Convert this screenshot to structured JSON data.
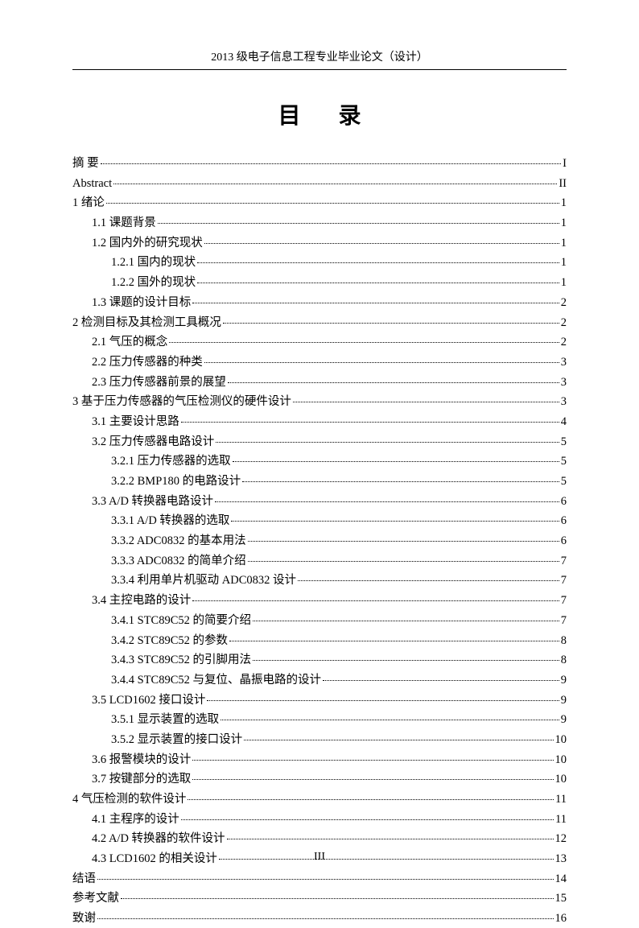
{
  "header": "2013 级电子信息工程专业毕业论文（设计）",
  "title": "目 录",
  "page_number": "III",
  "toc": [
    {
      "label": "摘   要",
      "page": "I",
      "indent": 0
    },
    {
      "label": "Abstract",
      "page": "II",
      "indent": 0
    },
    {
      "label": "1 绪论",
      "page": "1",
      "indent": 0
    },
    {
      "label": "1.1 课题背景",
      "page": "1",
      "indent": 1
    },
    {
      "label": "1.2 国内外的研究现状",
      "page": "1",
      "indent": 1
    },
    {
      "label": "1.2.1 国内的现状",
      "page": "1",
      "indent": 2
    },
    {
      "label": "1.2.2 国外的现状",
      "page": "1",
      "indent": 2
    },
    {
      "label": "1.3 课题的设计目标",
      "page": "2",
      "indent": 1
    },
    {
      "label": "2 检测目标及其检测工具概况",
      "page": "2",
      "indent": 0
    },
    {
      "label": "2.1 气压的概念",
      "page": "2",
      "indent": 1
    },
    {
      "label": "2.2 压力传感器的种类",
      "page": "3",
      "indent": 1
    },
    {
      "label": "2.3 压力传感器前景的展望",
      "page": "3",
      "indent": 1
    },
    {
      "label": "3 基于压力传感器的气压检测仪的硬件设计",
      "page": "3",
      "indent": 0
    },
    {
      "label": "3.1 主要设计思路",
      "page": "4",
      "indent": 1
    },
    {
      "label": "3.2 压力传感器电路设计",
      "page": "5",
      "indent": 1
    },
    {
      "label": "3.2.1 压力传感器的选取",
      "page": "5",
      "indent": 2
    },
    {
      "label": "3.2.2 BMP180 的电路设计",
      "page": "5",
      "indent": 2
    },
    {
      "label": "3.3  A/D 转换器电路设计",
      "page": "6",
      "indent": 1
    },
    {
      "label": "3.3.1 A/D 转换器的选取",
      "page": "6",
      "indent": 2
    },
    {
      "label": "3.3.2 ADC0832 的基本用法",
      "page": "6",
      "indent": 2
    },
    {
      "label": "3.3.3 ADC0832 的简单介绍",
      "page": "7",
      "indent": 2
    },
    {
      "label": "3.3.4 利用单片机驱动 ADC0832 设计",
      "page": "7",
      "indent": 2
    },
    {
      "label": "3.4 主控电路的设计",
      "page": "7",
      "indent": 1
    },
    {
      "label": "3.4.1 STC89C52 的简要介绍",
      "page": "7",
      "indent": 2
    },
    {
      "label": "3.4.2 STC89C52 的参数",
      "page": "8",
      "indent": 2
    },
    {
      "label": "3.4.3 STC89C52 的引脚用法",
      "page": "8",
      "indent": 2
    },
    {
      "label": "3.4.4 STC89C52 与复位、晶振电路的设计",
      "page": "9",
      "indent": 2
    },
    {
      "label": "3.5 LCD1602 接口设计",
      "page": "9",
      "indent": 1
    },
    {
      "label": "3.5.1 显示装置的选取",
      "page": "9",
      "indent": 2
    },
    {
      "label": "3.5.2 显示装置的接口设计",
      "page": "10",
      "indent": 2
    },
    {
      "label": "3.6 报警模块的设计",
      "page": "10",
      "indent": 1
    },
    {
      "label": "3.7 按键部分的选取",
      "page": "10",
      "indent": 1
    },
    {
      "label": "4  气压检测的软件设计",
      "page": "11",
      "indent": 0
    },
    {
      "label": "4.1 主程序的设计",
      "page": "11",
      "indent": 1
    },
    {
      "label": "4.2   A/D 转换器的软件设计",
      "page": "12",
      "indent": 1
    },
    {
      "label": "4.3 LCD1602 的相关设计",
      "page": "13",
      "indent": 1
    },
    {
      "label": "结语",
      "page": "14",
      "indent": 0
    },
    {
      "label": "参考文献",
      "page": "15",
      "indent": 0
    },
    {
      "label": "致谢",
      "page": "16",
      "indent": 0
    }
  ]
}
